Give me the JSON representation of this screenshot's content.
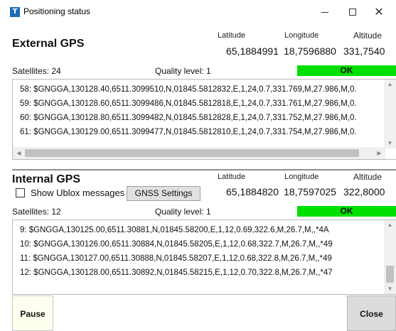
{
  "window": {
    "title": "Positioning status",
    "app_icon_letter": "T"
  },
  "colors": {
    "ok_green": "#00e000",
    "title_icon_blue": "#1e6ab8"
  },
  "labels": {
    "latitude": "Latitude",
    "longitude": "Longitude",
    "altitude": "Altitude"
  },
  "external_gps": {
    "title": "External GPS",
    "latitude": "65,1884991",
    "longitude": "18,7596880",
    "altitude": "331,7540",
    "satellites": "Satellites: 24",
    "quality": "Quality level: 1",
    "status": "OK",
    "log_lines": [
      "58: $GNGGA,130128.40,6511.3099510,N,01845.5812832,E,1,24,0.7,331.769,M,27.986,M,0.",
      "59: $GNGGA,130128.60,6511.3099486,N,01845.5812818,E,1,24,0.7,331.761,M,27.986,M,0.",
      "60: $GNGGA,130128.80,6511.3099482,N,01845.5812828,E,1,24,0.7,331.752,M,27.986,M,0.",
      "61: $GNGGA,130129.00,6511.3099477,N,01845.5812810,E,1,24,0.7,331.754,M,27.986,M,0."
    ]
  },
  "internal_gps": {
    "title": "Internal GPS",
    "show_ublox_label": "Show Ublox messages",
    "gnss_settings_label": "GNSS Settings",
    "latitude": "65,1884820",
    "longitude": "18,7597025",
    "altitude": "322,8000",
    "satellites": "Satellites: 12",
    "quality": "Quality level: 1",
    "status": "OK",
    "log_lines": [
      "9: $GNGGA,130125.00,6511.30881,N,01845.58200,E,1,12,0.69,322.6,M,26.7,M,,*4A",
      "10: $GNGGA,130126.00,6511.30884,N,01845.58205,E,1,12,0.68,322.7,M,26.7,M,,*49",
      "11: $GNGGA,130127.00,6511.30888,N,01845.58207,E,1,12,0.68,322.8,M,26.7,M,,*49",
      "12: $GNGGA,130128.00,6511.30892,N,01845.58215,E,1,12,0.70,322.8,M,26.7,M,,*47"
    ]
  },
  "buttons": {
    "pause": "Pause",
    "close": "Close"
  },
  "icons": {
    "minimize": "minimize-icon",
    "maximize": "maximize-icon",
    "close": "close-icon"
  }
}
